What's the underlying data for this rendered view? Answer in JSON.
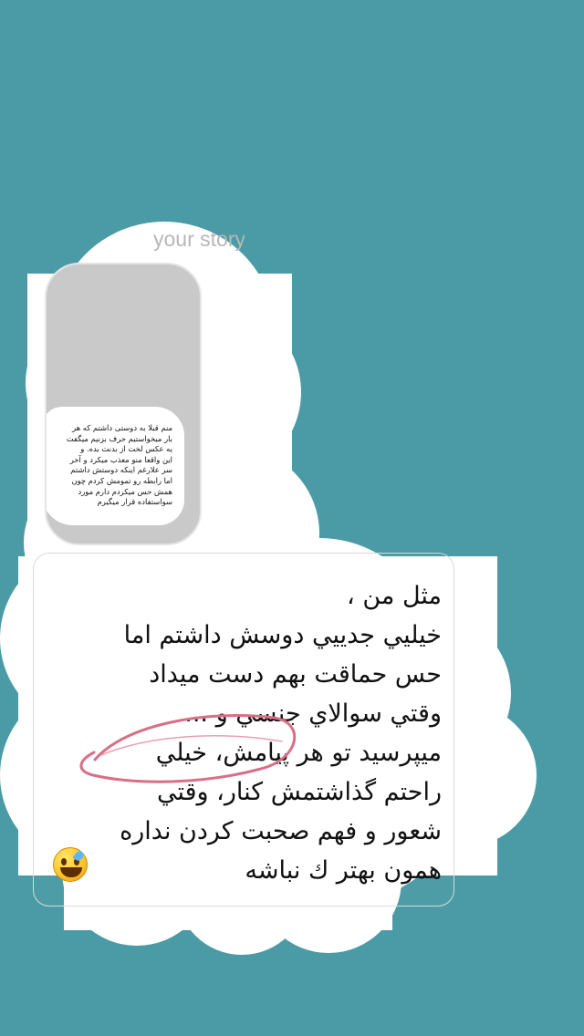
{
  "background": {
    "color": "#4a9ba5"
  },
  "story": {
    "header_text": "your story",
    "text_lines": [
      "منم قبلا به دوستی داشتم که هر",
      "بار میخواستیم حرف بزنیم میگفت",
      "یه عکس لخت از بدنت بده. و",
      "این واقعا منو معذب میکرد و آخر",
      "سر علارغم اینکه دوستش داشتم",
      "اما رابطه رو تمومش کردم چون",
      "همش حس میکردم دارم مورد",
      "سواستفاده قرار میگیرم"
    ]
  },
  "reply": {
    "lines": [
      "مثل من ،",
      "خيليي جدييي دوسش داشتم اما",
      "حس حماقت بهم دست ميداد",
      "وقتي سوالاي جنسي و ...",
      "ميپرسيد تو هر پيامش، خيلي",
      "راحتم گذاشتمش كنار، وقتي",
      "شعور و فهم صحبت كردن نداره",
      "همون بهتر ك نباشه"
    ],
    "emoji": "sweat-smile-emoji"
  },
  "annotation": {
    "color": "#d96f86",
    "icon": "hand-drawn-circle"
  }
}
